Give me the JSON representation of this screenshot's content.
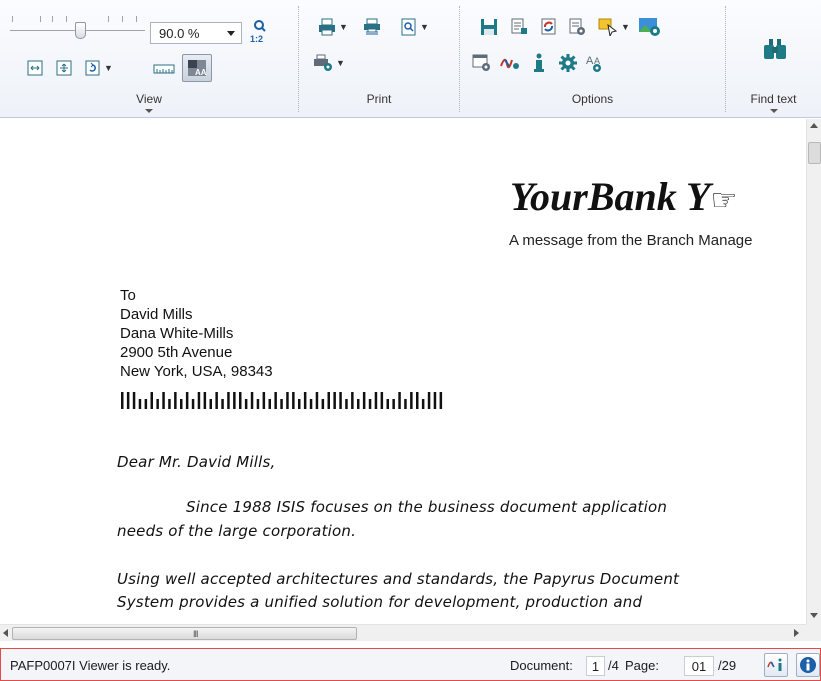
{
  "ribbon": {
    "view": {
      "label": "View",
      "zoom_value": "90.0 %",
      "zoom_ratio_label": "1:2"
    },
    "print": {
      "label": "Print"
    },
    "options": {
      "label": "Options"
    },
    "find": {
      "label": "Find text"
    }
  },
  "document": {
    "bank_name": "YourBank  Y",
    "subtitle": "A message from the Branch Manage",
    "address": [
      "To",
      "David Mills",
      "Dana White-Mills",
      "2900 5th Avenue",
      "New York, USA, 98343"
    ],
    "greeting": "Dear Mr. David Mills,",
    "para1_line1": "Since 1988 ISIS focuses on the business document application",
    "para1_line2": "needs of the large corporation.",
    "para2_line1": "Using well accepted architectures and standards, the Papyrus Document",
    "para2_line2": "System provides a unified solution for development, production and"
  },
  "status": {
    "message": "PAFP0007I Viewer is ready.",
    "document_label": "Document:",
    "document_value": "1",
    "document_total": "/4",
    "page_label": "Page:",
    "page_value": "01",
    "page_total": "/29"
  },
  "scroll": {
    "h_grip": "III"
  },
  "colors": {
    "accent": "#1c5fa8",
    "status_border": "#e44a4a",
    "teal": "#1e7a86"
  }
}
